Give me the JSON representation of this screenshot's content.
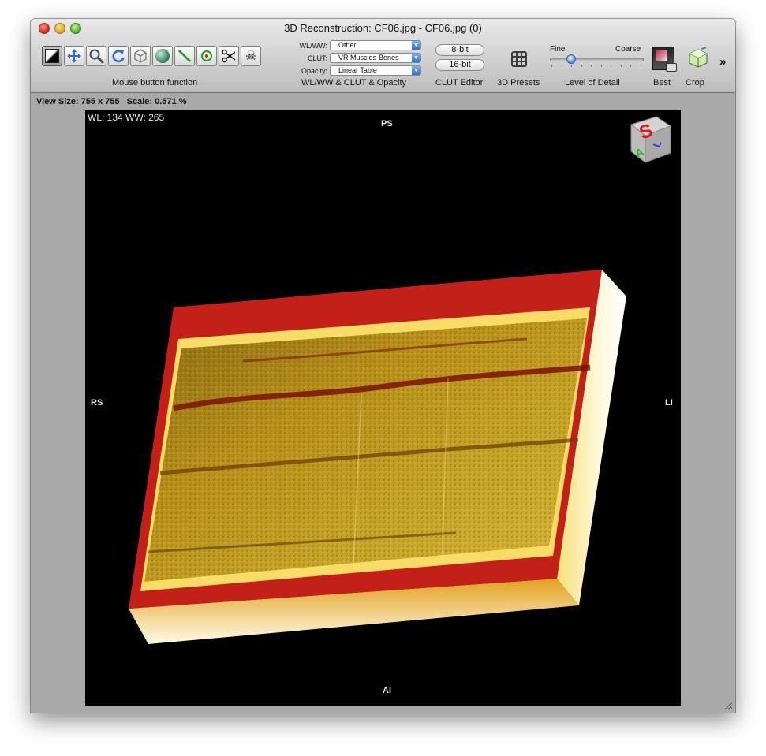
{
  "window": {
    "title": "3D Reconstruction: CF06.jpg - CF06.jpg (0)"
  },
  "toolbar": {
    "tools": [
      {
        "name": "wl-ww-tool",
        "icon": "contrast-icon"
      },
      {
        "name": "move-tool",
        "icon": "move-arrows-icon"
      },
      {
        "name": "zoom-tool",
        "icon": "magnifier-icon"
      },
      {
        "name": "rotate-tool",
        "icon": "rotate-icon"
      },
      {
        "name": "3d-rotate-tool",
        "icon": "cube-icon"
      },
      {
        "name": "sphere-tool",
        "icon": "sphere-icon"
      },
      {
        "name": "length-tool",
        "icon": "line-measure-icon"
      },
      {
        "name": "point-tool",
        "icon": "target-icon"
      },
      {
        "name": "scissors-tool",
        "icon": "scissors-icon"
      },
      {
        "name": "bone-removal-tool",
        "icon": "skull-crossbones-icon"
      }
    ],
    "mouse_label": "Mouse button function",
    "wlww_label": "WL/WW:",
    "wlww_value": "Other",
    "clut_label": "CLUT:",
    "clut_value": "VR Muscles-Bones",
    "opacity_label": "Opacity:",
    "opacity_value": "Linear Table",
    "group_label": "WL/WW & CLUT & Opacity",
    "bit8_label": "8-bit",
    "bit16_label": "16-bit",
    "clut_editor_label": "CLUT Editor",
    "presets_label": "3D Presets",
    "lod_fine": "Fine",
    "lod_coarse": "Coarse",
    "lod_label": "Level of Detail",
    "lod_value": 0.22,
    "best_label": "Best",
    "crop_label": "Crop",
    "more_label": "»"
  },
  "status": {
    "view_size": "View Size: 755 x 755",
    "scale": "Scale: 0.571 %"
  },
  "viewport": {
    "wlww_text": "WL: 134 WW: 265",
    "orient_top": "PS",
    "orient_left": "RS",
    "orient_right": "LI",
    "orient_bottom": "AI",
    "cube_face_top": "S",
    "cube_face_left": "A",
    "cube_face_right": "L"
  },
  "colors": {
    "accent_blue": "#2a6fd8",
    "volume_red": "#c4201a",
    "volume_gold": "#b8901a"
  }
}
